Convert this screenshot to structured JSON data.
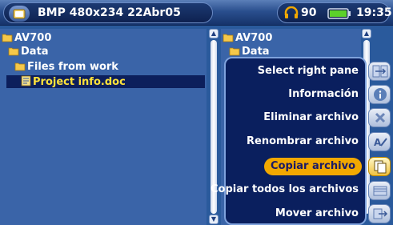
{
  "header": {
    "title": "BMP 480x234 22Abr05",
    "volume": "90",
    "time": "19:35",
    "icons": [
      "folder-browser-icon",
      "headphones-icon",
      "battery-icon"
    ]
  },
  "left_pane": {
    "items": [
      {
        "label": "AV700",
        "type": "folder"
      },
      {
        "label": "Data",
        "type": "folder"
      },
      {
        "label": "Files from work",
        "type": "folder"
      },
      {
        "label": "Project info.doc",
        "type": "file",
        "selected": true
      }
    ]
  },
  "right_pane": {
    "items": [
      {
        "label": "AV700",
        "type": "folder"
      },
      {
        "label": "Data",
        "type": "folder"
      }
    ]
  },
  "menu": {
    "items": [
      {
        "label": "Select right pane",
        "icon": "pane-switch-icon"
      },
      {
        "label": "Información",
        "icon": "info-icon"
      },
      {
        "label": "Eliminar archivo",
        "icon": "delete-icon"
      },
      {
        "label": "Renombrar archivo",
        "icon": "rename-icon"
      },
      {
        "label": "Copiar archivo",
        "icon": "copy-icon",
        "active": true
      },
      {
        "label": "Copiar todos los archivos",
        "icon": "copy-all-icon"
      },
      {
        "label": "Mover archivo",
        "icon": "move-icon"
      }
    ]
  },
  "colors": {
    "background": "#2a5a9c",
    "selection": "#0c1f5c",
    "selected_text": "#ffe23a",
    "menu_bg": "#0a1f5e",
    "menu_highlight": "#f2a800"
  }
}
